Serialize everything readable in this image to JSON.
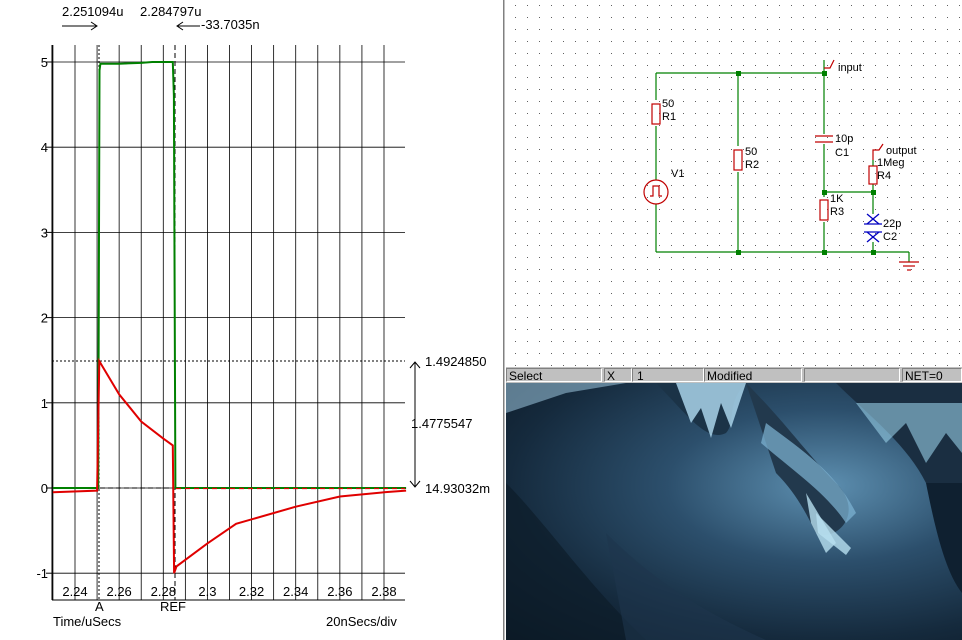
{
  "scope": {
    "cursor_a_time": "2.251094u",
    "cursor_b_time": "2.284797u",
    "cursor_delta": "-33.7035n",
    "y_ticks": [
      "5",
      "4",
      "3",
      "2",
      "1",
      "0",
      "-1"
    ],
    "x_ticks": [
      "2.24",
      "2.26",
      "2.28",
      "2.3",
      "2.32",
      "2.34",
      "2.36",
      "2.38"
    ],
    "cursor_a_label": "A",
    "cursor_ref_label": "REF",
    "x_axis_label": "Time/uSecs",
    "scale_label": "20nSecs/div",
    "upper_value": "1.4924850",
    "delta_value": "1.4775547",
    "lower_value": "14.93032m",
    "colors": {
      "green": "#008000",
      "red": "#e00000",
      "grid": "#000000"
    }
  },
  "chart_data": {
    "type": "line",
    "title": "",
    "xlabel": "Time/uSecs",
    "ylabel": "",
    "xlim": [
      2.23,
      2.39
    ],
    "ylim": [
      -1.1,
      5.2
    ],
    "grid": true,
    "series": [
      {
        "color": "#008000",
        "x": [
          2.23,
          2.2505,
          2.2511,
          2.2515,
          2.26,
          2.27,
          2.275,
          2.278,
          2.2843,
          2.2848,
          2.2855,
          2.3,
          2.39
        ],
        "y": [
          0.0,
          0.0,
          4.9,
          4.98,
          4.98,
          4.99,
          5.0,
          5.0,
          5.0,
          4.6,
          0.0,
          0.0,
          0.0
        ]
      },
      {
        "color": "#e00000",
        "x": [
          2.23,
          2.25,
          2.251,
          2.26,
          2.27,
          2.28,
          2.2843,
          2.2849,
          2.286,
          2.3,
          2.313,
          2.34,
          2.36,
          2.38,
          2.39
        ],
        "y": [
          -0.05,
          -0.03,
          1.49,
          1.1,
          0.78,
          0.58,
          0.5,
          -1.0,
          -0.92,
          -0.65,
          -0.42,
          -0.22,
          -0.1,
          -0.05,
          -0.03
        ]
      }
    ]
  },
  "schematic": {
    "r1_value": "50",
    "r1_name": "R1",
    "r2_value": "50",
    "r2_name": "R2",
    "r3_value": "1K",
    "r3_name": "R3",
    "r4_value": "1Meg",
    "r4_name": "R4",
    "c1_value": "10p",
    "c1_name": "C1",
    "c2_value": "22p",
    "c2_name": "C2",
    "v1_name": "V1",
    "input_label": "input",
    "output_label": "output"
  },
  "statusbar": {
    "mode": "Select",
    "x_label": "X",
    "x_value": "1",
    "modified": "Modified",
    "blank": "",
    "net": "NET=0"
  }
}
